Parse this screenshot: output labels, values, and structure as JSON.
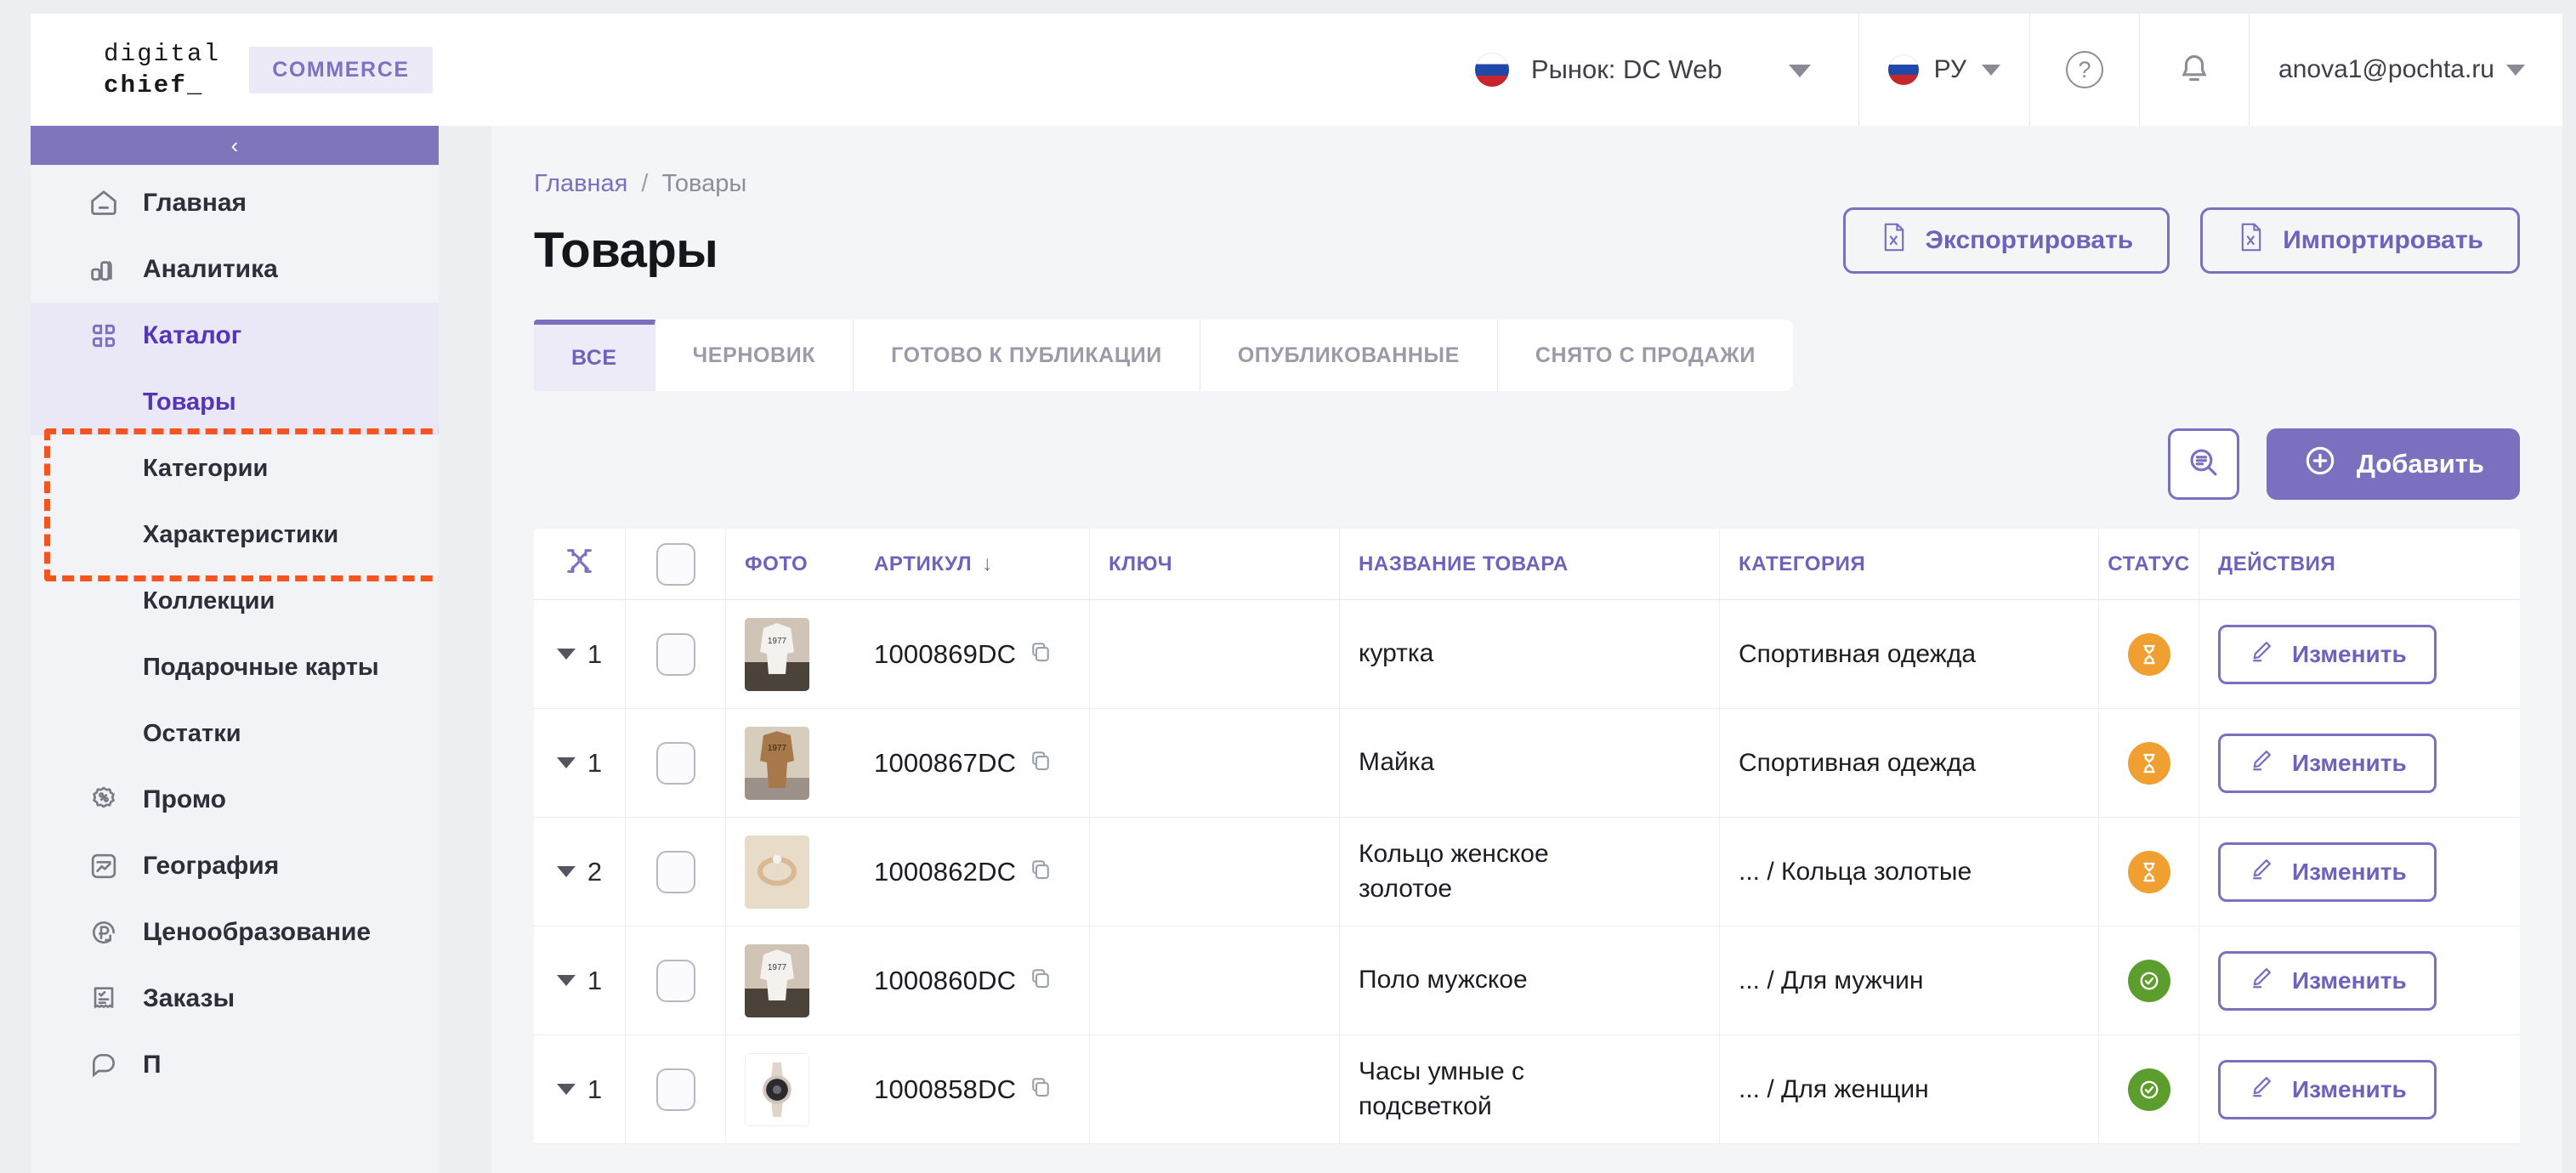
{
  "brand": {
    "logo_line1": "digital",
    "logo_line2": "chief_",
    "tag": "COMMERCE"
  },
  "topbar": {
    "market_label": "Рынок: DC Web",
    "language": "РУ",
    "help_icon": "question-mark-circle-icon",
    "notifications_icon": "bell-icon",
    "user_email": "anova1@pochta.ru"
  },
  "sidebar": {
    "collapse_label": "‹",
    "items": [
      {
        "label": "Главная",
        "icon": "home-icon",
        "active": false
      },
      {
        "label": "Аналитика",
        "icon": "chart-bar-icon",
        "active": false
      },
      {
        "label": "Каталог",
        "icon": "grid-squares-icon",
        "active": true
      },
      {
        "label": "Промо",
        "icon": "percent-badge-icon",
        "active": false
      },
      {
        "label": "География",
        "icon": "trend-map-icon",
        "active": false
      },
      {
        "label": "Ценообразование",
        "icon": "ruble-refresh-icon",
        "active": false
      },
      {
        "label": "Заказы",
        "icon": "receipt-check-icon",
        "active": false
      }
    ],
    "catalog_children": [
      {
        "label": "Товары",
        "active": true
      },
      {
        "label": "Категории",
        "active": false
      },
      {
        "label": "Характеристики",
        "active": false
      },
      {
        "label": "Коллекции",
        "active": false
      },
      {
        "label": "Подарочные карты",
        "active": false
      },
      {
        "label": "Остатки",
        "active": false
      }
    ],
    "highlight_color": "#F4541F"
  },
  "breadcrumb": {
    "root": "Главная",
    "separator": "/",
    "current": "Товары"
  },
  "page": {
    "title": "Товары",
    "export_label": "Экспортировать",
    "export_icon": "file-excel-icon",
    "import_label": "Импортировать",
    "import_icon": "file-excel-icon"
  },
  "tabs": [
    {
      "label": "ВСЕ",
      "active": true
    },
    {
      "label": "ЧЕРНОВИК",
      "active": false
    },
    {
      "label": "ГОТОВО К ПУБЛИКАЦИИ",
      "active": false
    },
    {
      "label": "ОПУБЛИКОВАННЫЕ",
      "active": false
    },
    {
      "label": "СНЯТО С ПРОДАЖИ",
      "active": false
    }
  ],
  "toolbar": {
    "search_icon": "search-list-icon",
    "add_label": "Добавить",
    "add_icon": "plus-circle-icon"
  },
  "table": {
    "collapse_icon": "collapse-arrows-icon",
    "select_all_checkbox": false,
    "columns": [
      {
        "key": "expand",
        "label": ""
      },
      {
        "key": "check",
        "label": ""
      },
      {
        "key": "photo",
        "label": "ФОТО"
      },
      {
        "key": "sku",
        "label": "АРТИКУЛ",
        "sort": "↓"
      },
      {
        "key": "ikey",
        "label": "КЛЮЧ"
      },
      {
        "key": "name",
        "label": "НАЗВАНИЕ ТОВАРА"
      },
      {
        "key": "cat",
        "label": "КАТЕГОРИЯ"
      },
      {
        "key": "status",
        "label": "СТАТУС"
      },
      {
        "key": "act",
        "label": "ДЕЙСТВИЯ"
      }
    ],
    "edit_label": "Изменить",
    "edit_icon": "pencil-icon",
    "copy_icon": "copy-icon",
    "rows": [
      {
        "variants": "1",
        "checked": false,
        "photo_alt": "белая футболка 1977",
        "sku": "1000869DC",
        "ikey": "",
        "name": "куртка",
        "category": "Спортивная одежда",
        "status": "pending",
        "status_icon": "hourglass-icon"
      },
      {
        "variants": "1",
        "checked": false,
        "photo_alt": "бежевая футболка 1977",
        "sku": "1000867DC",
        "ikey": "",
        "name": "Майка",
        "category": "Спортивная одежда",
        "status": "pending",
        "status_icon": "hourglass-icon"
      },
      {
        "variants": "2",
        "checked": false,
        "photo_alt": "золотое кольцо",
        "sku": "1000862DC",
        "ikey": "",
        "name": "Кольцо женское золотое",
        "category": "... / Кольца золотые",
        "status": "pending",
        "status_icon": "hourglass-icon"
      },
      {
        "variants": "1",
        "checked": false,
        "photo_alt": "белая футболка 1977",
        "sku": "1000860DC",
        "ikey": "",
        "name": "Поло мужское",
        "category": "... / Для мужчин",
        "status": "published",
        "status_icon": "check-circle-icon"
      },
      {
        "variants": "1",
        "checked": false,
        "photo_alt": "умные часы",
        "sku": "1000858DC",
        "ikey": "",
        "name": "Часы умные с подсветкой",
        "category": "... / Для женщин",
        "status": "published",
        "status_icon": "check-circle-icon"
      }
    ]
  },
  "colors": {
    "accent": "#7B6FC0",
    "accent_dark": "#5536B8",
    "active_bg": "#EAE7F7",
    "highlight": "#F4541F",
    "status_pending": "#F0A030",
    "status_published": "#5C9E2E",
    "page_bg": "#ECEEF2"
  }
}
